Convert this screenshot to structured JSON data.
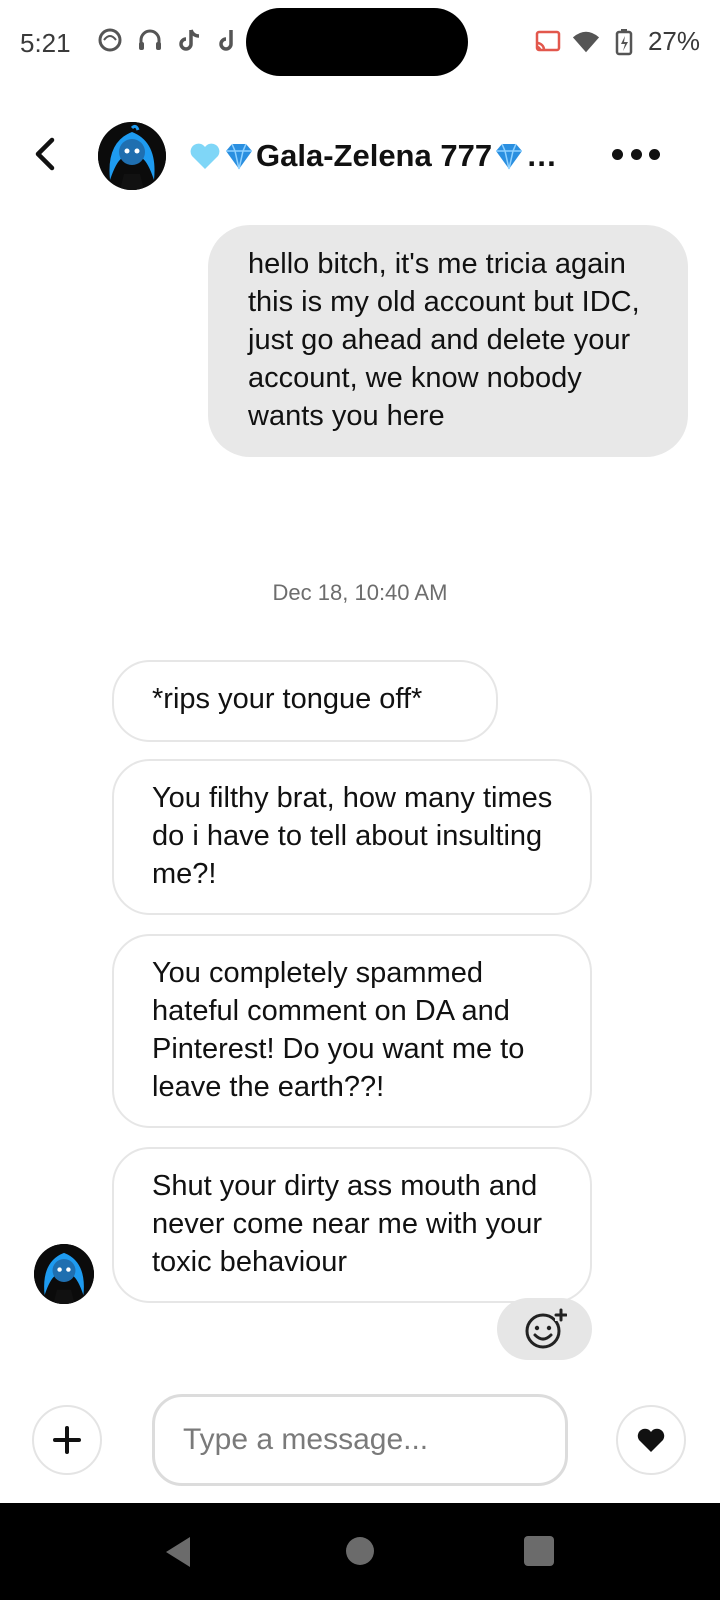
{
  "status_bar": {
    "time": "5:21",
    "battery": "27%",
    "icons": [
      "notification-icon",
      "headphones-icon",
      "tiktok-icon",
      "tiktok-icon",
      "cast-icon",
      "wifi-icon",
      "battery-charging-icon"
    ]
  },
  "header": {
    "contact_name": "Gala-Zelena 777",
    "name_emojis_before": [
      "light-blue-heart",
      "gem"
    ],
    "name_emoji_after": "gem",
    "name_ellipsis": "…",
    "back_icon": "chevron-left-icon",
    "more_icon": "more-horizontal-icon"
  },
  "messages": {
    "outgoing_1": "hello bitch, it's me tricia again this is my old account but IDC, just go ahead and delete your account, we know nobody wants you here",
    "timestamp": "Dec 18, 10:40 AM",
    "incoming_1": "*rips your tongue off*",
    "incoming_2": "You filthy brat, how many times do i have to tell about insulting me?!",
    "incoming_3": "You completely spammed hateful comment on DA and Pinterest! Do you want me to leave the earth??!",
    "incoming_4": "Shut your dirty ass mouth and never come near me with your toxic behaviour"
  },
  "composer": {
    "placeholder": "Type a message...",
    "value": "",
    "add_icon": "plus-icon",
    "like_icon": "heart-icon",
    "react_icon": "emoji-add-icon"
  },
  "colors": {
    "outgoing_bubble": "#e8e8e8",
    "incoming_border": "#e6e6e6",
    "accent_blue": "#1e9bf0"
  },
  "nav_bar": {
    "icons": [
      "nav-back-icon",
      "nav-home-icon",
      "nav-recents-icon"
    ]
  }
}
